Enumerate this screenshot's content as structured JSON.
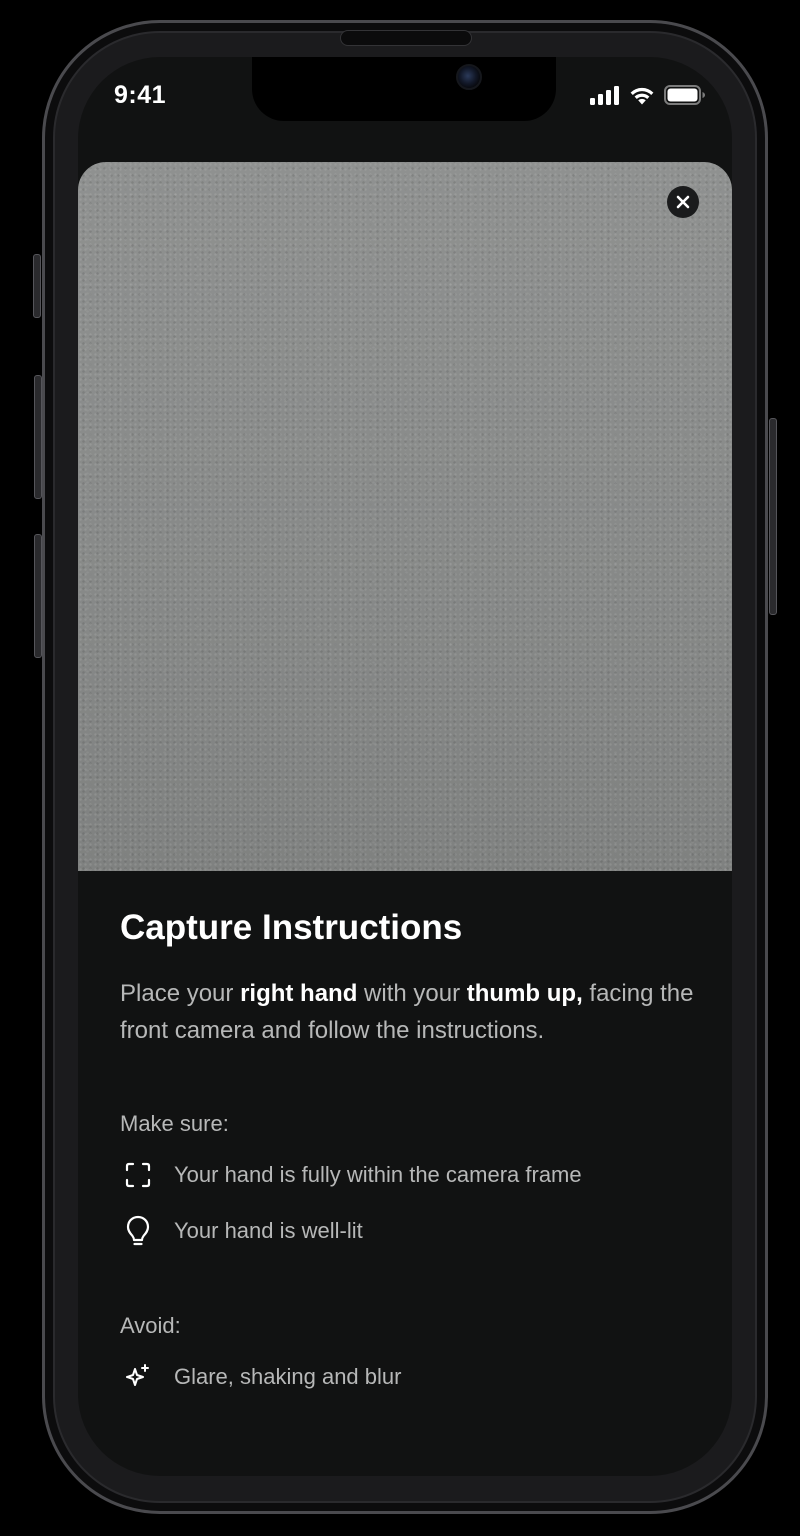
{
  "status_bar": {
    "time": "9:41"
  },
  "camera": {
    "close_icon": "close-icon"
  },
  "instructions": {
    "title": "Capture Instructions",
    "description": {
      "part1": "Place your ",
      "bold1": "right hand",
      "part2": " with your ",
      "bold2": "thumb up,",
      "part3": " facing the front camera and follow the instructions."
    },
    "make_sure_label": "Make sure:",
    "make_sure_items": [
      {
        "icon": "frame-corners-icon",
        "text": "Your hand is fully within the camera frame"
      },
      {
        "icon": "lightbulb-icon",
        "text": "Your hand is well-lit"
      }
    ],
    "avoid_label": "Avoid:",
    "avoid_items": [
      {
        "icon": "sparkle-icon",
        "text": "Glare, shaking and blur"
      }
    ]
  },
  "colors": {
    "background": "#111212",
    "text_primary": "#ffffff",
    "text_secondary": "#b7b8b8",
    "camera_preview": "#8b8d8c"
  }
}
